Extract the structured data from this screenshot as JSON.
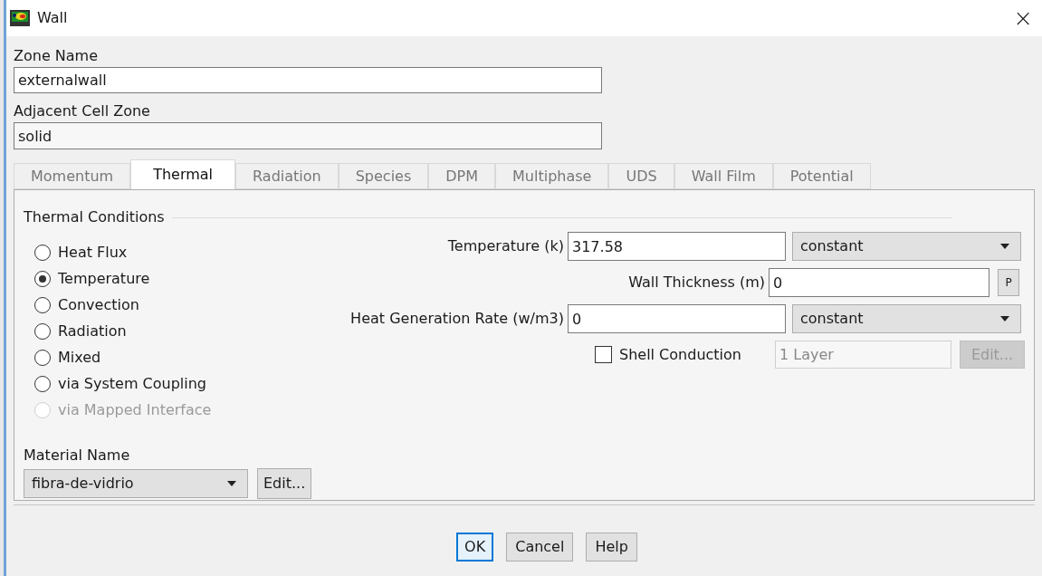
{
  "window": {
    "title": "Wall",
    "close": "×"
  },
  "zone_name": {
    "label": "Zone Name",
    "value": "externalwall"
  },
  "adjacent_cell_zone": {
    "label": "Adjacent Cell Zone",
    "value": "solid"
  },
  "tabs": [
    {
      "label": "Momentum",
      "selected": false
    },
    {
      "label": "Thermal",
      "selected": true
    },
    {
      "label": "Radiation",
      "selected": false
    },
    {
      "label": "Species",
      "selected": false
    },
    {
      "label": "DPM",
      "selected": false
    },
    {
      "label": "Multiphase",
      "selected": false
    },
    {
      "label": "UDS",
      "selected": false
    },
    {
      "label": "Wall Film",
      "selected": false
    },
    {
      "label": "Potential",
      "selected": false
    }
  ],
  "thermal_conditions": {
    "title": "Thermal Conditions",
    "options": [
      {
        "label": "Heat Flux",
        "selected": false,
        "disabled": false
      },
      {
        "label": "Temperature",
        "selected": true,
        "disabled": false
      },
      {
        "label": "Convection",
        "selected": false,
        "disabled": false
      },
      {
        "label": "Radiation",
        "selected": false,
        "disabled": false
      },
      {
        "label": "Mixed",
        "selected": false,
        "disabled": false
      },
      {
        "label": "via System Coupling",
        "selected": false,
        "disabled": false
      },
      {
        "label": "via Mapped Interface",
        "selected": false,
        "disabled": true
      }
    ]
  },
  "material": {
    "label": "Material Name",
    "value": "fibra-de-vidrio",
    "edit_button": "Edit..."
  },
  "temperature": {
    "label": "Temperature (k)",
    "value": "317.58",
    "method": "constant"
  },
  "wall_thickness": {
    "label": "Wall Thickness (m)",
    "value": "0",
    "button": "P"
  },
  "heat_generation": {
    "label": "Heat Generation Rate (w/m3)",
    "value": "0",
    "method": "constant"
  },
  "shell_conduction": {
    "label": "Shell Conduction",
    "checked": false,
    "layers": "1 Layer",
    "edit_button": {
      "label": "Edit...",
      "disabled": true
    }
  },
  "buttons": [
    {
      "label": "OK",
      "focused": true
    },
    {
      "label": "Cancel",
      "focused": false
    },
    {
      "label": "Help",
      "focused": false
    }
  ]
}
